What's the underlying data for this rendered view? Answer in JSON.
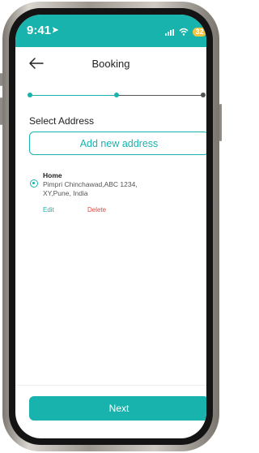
{
  "status_bar": {
    "time": "9:41",
    "battery": "32"
  },
  "header": {
    "title": "Booking"
  },
  "stepper": {
    "total_steps": 3,
    "completed_steps": 2
  },
  "address": {
    "section_title": "Select Address",
    "add_button_label": "Add new address",
    "saved": [
      {
        "name": "Home",
        "line1": "Pimpri Chinchawad,ABC 1234,",
        "line2": "XY,Pune, India",
        "selected": true,
        "edit_label": "Edit",
        "delete_label": "Delete"
      }
    ]
  },
  "footer": {
    "next_label": "Next"
  },
  "colors": {
    "accent": "#19b3ad",
    "danger": "#e0493f",
    "status_bar": "#19b3ad"
  },
  "icons": [
    "back-arrow-icon",
    "signal-icon",
    "wifi-icon",
    "battery-icon",
    "location-arrow-icon"
  ]
}
